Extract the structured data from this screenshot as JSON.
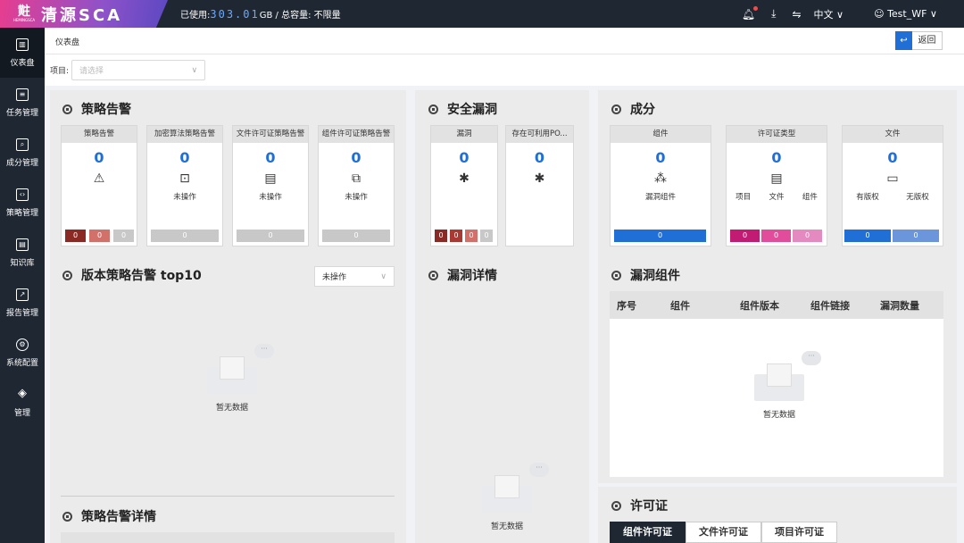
{
  "header": {
    "logo_glyph": "黈",
    "logo_sub": "HEMINGSCA",
    "logo_text": "清源SCA",
    "usage_label": "已使用:",
    "usage_value": "303.01",
    "usage_suffix": "GB / 总容量: 不限量",
    "language": "中文",
    "user": "Test_WF"
  },
  "sidebar": {
    "items": [
      {
        "label": "仪表盘",
        "icon": "dashboard-icon"
      },
      {
        "label": "任务管理",
        "icon": "task-icon"
      },
      {
        "label": "成分管理",
        "icon": "component-icon"
      },
      {
        "label": "策略管理",
        "icon": "policy-icon"
      },
      {
        "label": "知识库",
        "icon": "knowledge-icon"
      },
      {
        "label": "报告管理",
        "icon": "report-icon"
      },
      {
        "label": "系统配置",
        "icon": "settings-icon"
      },
      {
        "label": "管理",
        "icon": "layers-icon"
      }
    ]
  },
  "breadcrumb": "仪表盘",
  "back_label": "返回",
  "filter": {
    "label": "项目:",
    "placeholder": "请选择"
  },
  "policy_alert": {
    "title": "策略告警",
    "cards": [
      {
        "header": "策略告警",
        "value": "0",
        "caption": ""
      },
      {
        "header": "加密算法策略告警",
        "value": "0",
        "caption": "未操作",
        "bar": "0"
      },
      {
        "header": "文件许可证策略告警",
        "value": "0",
        "caption": "未操作",
        "bar": "0"
      },
      {
        "header": "组件许可证策略告警",
        "value": "0",
        "caption": "未操作",
        "bar": "0"
      }
    ],
    "severity_bars": [
      "0",
      "0",
      "0"
    ]
  },
  "version_alert": {
    "title": "版本策略告警 top10",
    "dropdown": "未操作",
    "empty": "暂无数据"
  },
  "alert_detail": {
    "title": "策略告警详情"
  },
  "vuln": {
    "title": "安全漏洞",
    "cards": [
      {
        "header": "漏洞",
        "value": "0"
      },
      {
        "header": "存在可利用PO...",
        "value": "0"
      }
    ],
    "severity_bars": [
      "0",
      "0",
      "0",
      "0"
    ]
  },
  "vuln_detail": {
    "title": "漏洞详情",
    "empty": "暂无数据"
  },
  "composition": {
    "title": "成分",
    "cards": [
      {
        "header": "组件",
        "value": "0",
        "labels": [
          "漏洞组件"
        ],
        "bars": [
          "0"
        ]
      },
      {
        "header": "许可证类型",
        "value": "0",
        "labels": [
          "项目",
          "文件",
          "组件"
        ],
        "bars": [
          "0",
          "0",
          "0"
        ]
      },
      {
        "header": "文件",
        "value": "0",
        "labels": [
          "有版权",
          "无版权"
        ],
        "bars": [
          "0",
          "0"
        ]
      }
    ]
  },
  "vuln_components": {
    "title": "漏洞组件",
    "columns": [
      "序号",
      "组件",
      "组件版本",
      "组件链接",
      "漏洞数量"
    ],
    "empty": "暂无数据"
  },
  "license": {
    "title": "许可证",
    "tabs": [
      "组件许可证",
      "文件许可证",
      "项目许可证"
    ]
  },
  "colors": {
    "dark_red": "#8b2a24",
    "red": "#d2706a",
    "gray": "#c8c8c8",
    "blue": "#1f6fd6",
    "light_blue": "#6b96dc",
    "magenta": "#c21b73",
    "pink": "#e14c9b",
    "light_pink": "#e58ac0"
  }
}
